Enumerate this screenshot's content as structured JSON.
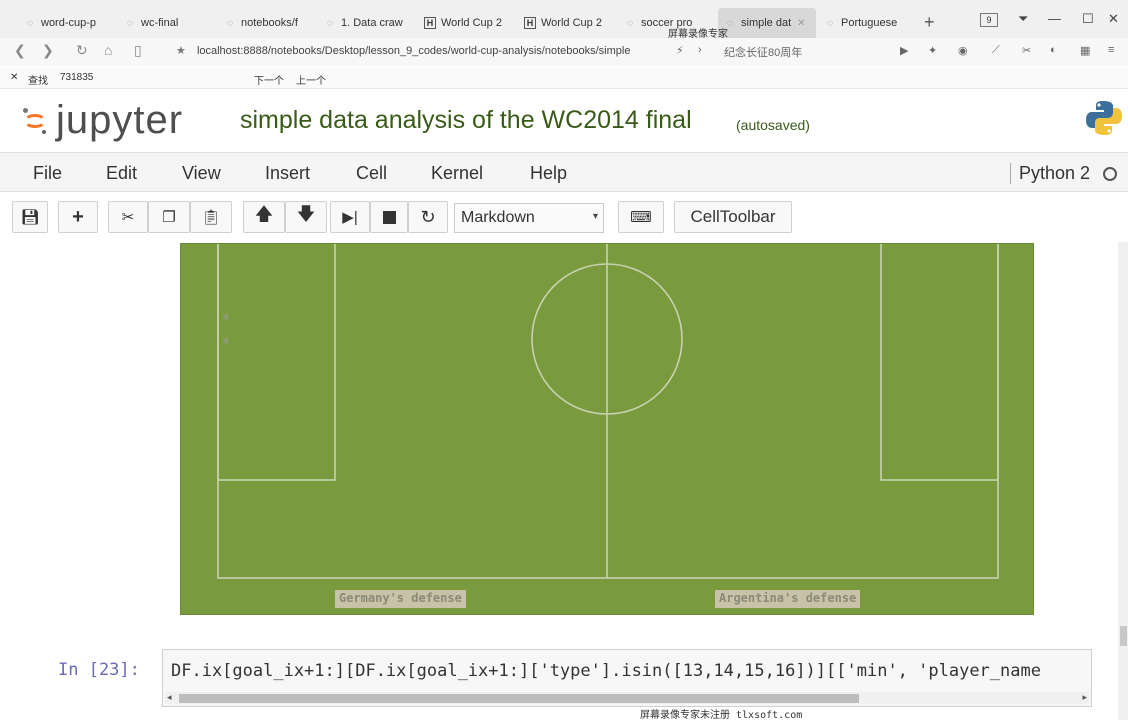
{
  "browser": {
    "tabs": [
      {
        "label": "word-cup-p",
        "icon": "jupyter-icon",
        "active": false
      },
      {
        "label": "wc-final",
        "icon": "jupyter-icon",
        "active": false
      },
      {
        "label": "notebooks/f",
        "icon": "jupyter-icon",
        "active": false
      },
      {
        "label": "1. Data craw",
        "icon": "jupyter-icon",
        "active": false
      },
      {
        "label": "World Cup 2",
        "icon": "h-icon",
        "active": false
      },
      {
        "label": "World Cup 2",
        "icon": "h-icon",
        "active": false
      },
      {
        "label": "soccer pro",
        "icon": "jupyter-icon",
        "active": false
      },
      {
        "label": "simple dat",
        "icon": "jupyter-icon",
        "active": true
      },
      {
        "label": "Portuguese",
        "icon": "jupyter-icon",
        "active": false
      }
    ],
    "tab_count": "9",
    "url": "localhost:8888/notebooks/Desktop/lesson_9_codes/world-cup-analysis/notebooks/simple",
    "bookmark": "纪念长征80周年",
    "find": {
      "label": "查找",
      "query": "731835",
      "next": "下一个",
      "prev": "上一个"
    },
    "recorder_overlay": "屏幕录像专家"
  },
  "jupyter": {
    "logo_text": "jupyter",
    "notebook_title": "simple data analysis of the WC2014 final",
    "save_status": "(autosaved)",
    "menu": [
      "File",
      "Edit",
      "View",
      "Insert",
      "Cell",
      "Kernel",
      "Help"
    ],
    "kernel_name": "Python 2",
    "cell_type": "Markdown",
    "cell_toolbar_label": "CellToolbar"
  },
  "figure": {
    "pitch_color": "#7a9a3e",
    "left_label": "Germany's defense",
    "right_label": "Argentina's defense"
  },
  "code_cell": {
    "prompt": "In  [23]:",
    "source": "DF.ix[goal_ix+1:][DF.ix[goal_ix+1:]['type'].isin([13,14,15,16])][['min', 'player_name"
  },
  "watermark": "屏幕录像专家未注册 tlxsoft.com"
}
